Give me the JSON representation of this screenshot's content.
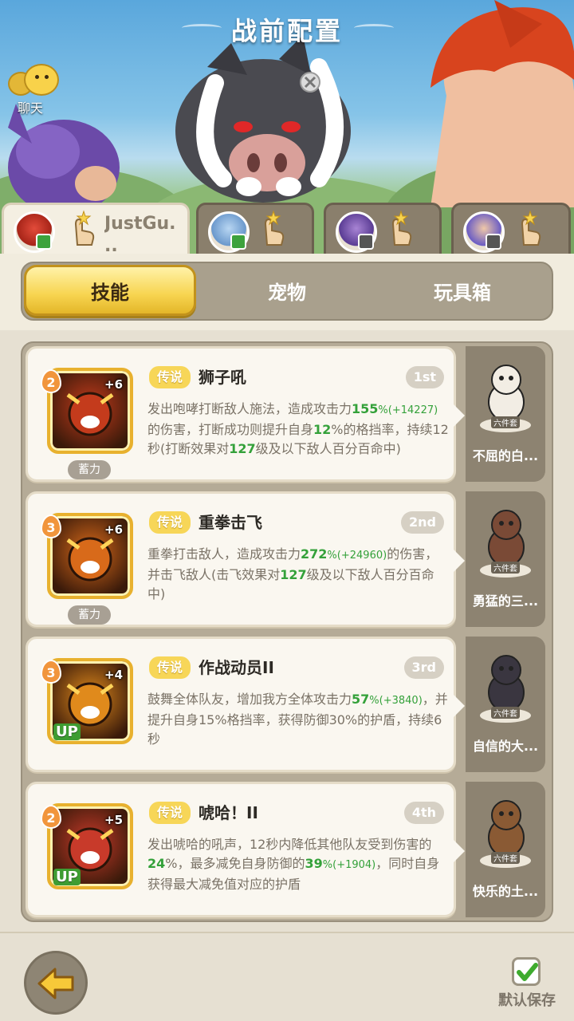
{
  "header": {
    "title": "战前配置",
    "chat_label": "聊天"
  },
  "heroes": [
    {
      "name": "JustGu.\n..",
      "avatar_color": "#c7302c",
      "active": true
    },
    {
      "name": "",
      "avatar_color": "#8ab9e8",
      "active": false
    },
    {
      "name": "",
      "avatar_color": "#8a64b4",
      "active": false
    },
    {
      "name": "",
      "avatar_color": "#6a5cc4",
      "active": false
    }
  ],
  "categories": [
    {
      "label": "技能",
      "active": true
    },
    {
      "label": "宠物",
      "active": false
    },
    {
      "label": "玩具箱",
      "active": false
    }
  ],
  "skills": [
    {
      "level": "2",
      "plus": "+6",
      "tag": "蓄力",
      "up": "",
      "rarity": "传说",
      "name": "狮子吼",
      "slot": "1st",
      "icon_color": "#c43b1c",
      "desc": [
        {
          "t": "发出咆哮打断敌人施法，造成攻击力"
        },
        {
          "t": "155",
          "h": 1
        },
        {
          "t": "%(",
          "s": 1
        },
        {
          "t": "+14227",
          "s": 1
        },
        {
          "t": ")",
          "s": 1
        },
        {
          "t": "的伤害，打断成功则提升自身"
        },
        {
          "t": "12",
          "h": 1
        },
        {
          "t": "%的格挡率，持续12秒(打断效果对"
        },
        {
          "t": "127",
          "h": 1
        },
        {
          "t": "级及以下敌人百分百命中)"
        }
      ],
      "pet": {
        "name": "不屈的白...",
        "set": "六件套",
        "color": "#f2ede4"
      }
    },
    {
      "level": "3",
      "plus": "+6",
      "tag": "蓄力",
      "up": "",
      "rarity": "传说",
      "name": "重拳击飞",
      "slot": "2nd",
      "icon_color": "#d86a1a",
      "desc": [
        {
          "t": "重拳打击敌人，造成攻击力"
        },
        {
          "t": "272",
          "h": 1
        },
        {
          "t": "%(",
          "s": 1
        },
        {
          "t": "+24960",
          "s": 1
        },
        {
          "t": ")",
          "s": 1
        },
        {
          "t": "的伤害，并击飞敌人(击飞效果对"
        },
        {
          "t": "127",
          "h": 1
        },
        {
          "t": "级及以下敌人百分百命中)"
        }
      ],
      "pet": {
        "name": "勇猛的三...",
        "set": "六件套",
        "color": "#7a4a36"
      }
    },
    {
      "level": "3",
      "plus": "+4",
      "tag": "",
      "up": "UP",
      "rarity": "传说",
      "name": "作战动员II",
      "slot": "3rd",
      "icon_color": "#e08a1c",
      "desc": [
        {
          "t": "鼓舞全体队友，增加我方全体攻击力"
        },
        {
          "t": "57",
          "h": 1
        },
        {
          "t": "%(",
          "s": 1
        },
        {
          "t": "+3840",
          "s": 1
        },
        {
          "t": ")",
          "s": 1
        },
        {
          "t": "，并提升自身15%格挡率，获得防御30%的护盾，持续6秒"
        }
      ],
      "pet": {
        "name": "自信的大...",
        "set": "六件套",
        "color": "#3a3640"
      }
    },
    {
      "level": "2",
      "plus": "+5",
      "tag": "",
      "up": "UP",
      "rarity": "传说",
      "name": "唬哈！II",
      "slot": "4th",
      "icon_color": "#c83a2a",
      "desc": [
        {
          "t": "发出唬哈的吼声，12秒内降低其他队友受到伤害的"
        },
        {
          "t": "24",
          "h": 1
        },
        {
          "t": "%，最多减免自身防御的"
        },
        {
          "t": "39",
          "h": 1
        },
        {
          "t": "%(",
          "s": 1
        },
        {
          "t": "+1904",
          "s": 1
        },
        {
          "t": ")",
          "s": 1
        },
        {
          "t": "，同时自身获得最大减免值对应的护盾"
        }
      ],
      "pet": {
        "name": "快乐的土...",
        "set": "六件套",
        "color": "#8a5a34"
      }
    }
  ],
  "footer": {
    "save_label": "默认保存",
    "save_checked": true
  },
  "colors": {
    "accent": "#f7d44f",
    "highlight": "#34a13a",
    "card": "#faf7f0"
  }
}
